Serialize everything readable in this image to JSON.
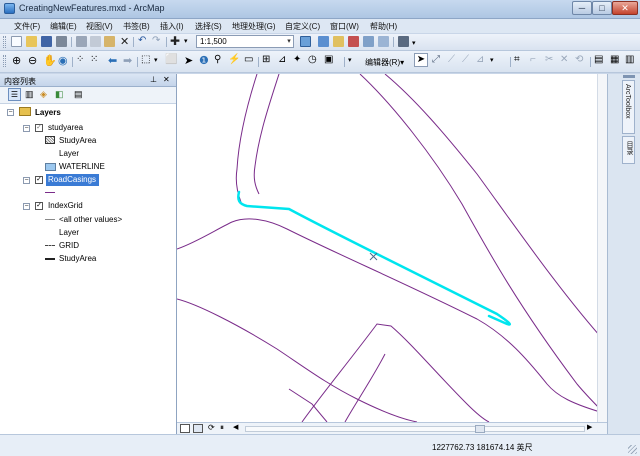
{
  "window": {
    "title": "CreatingNewFeatures.mxd - ArcMap"
  },
  "menu": [
    "文件(F)",
    "编辑(E)",
    "视图(V)",
    "书签(B)",
    "插入(I)",
    "选择(S)",
    "地理处理(G)",
    "自定义(C)",
    "窗口(W)",
    "帮助(H)"
  ],
  "toolbar": {
    "scale": "1:1,500",
    "editor_label": "编辑器(R)▾"
  },
  "toc": {
    "title": "内容列表",
    "layers_label": "Layers",
    "items": [
      {
        "label": "studyarea"
      },
      {
        "label": "StudyArea"
      },
      {
        "label": "Layer"
      },
      {
        "label": "WATERLINE"
      },
      {
        "label": "RoadCasings"
      },
      {
        "label": "IndexGrid"
      },
      {
        "label": "<all other values>"
      },
      {
        "label": "Layer"
      },
      {
        "label": "GRID"
      },
      {
        "label": "StudyArea"
      }
    ]
  },
  "dock": {
    "tab1": "ArcToolbox",
    "tab2": "目录"
  },
  "status": {
    "coords": "1227762.73  181674.14 英尺"
  },
  "colors": {
    "selection": "#00e5ee",
    "road": "#7a2c8a",
    "highlight": "#3a7bd5"
  }
}
